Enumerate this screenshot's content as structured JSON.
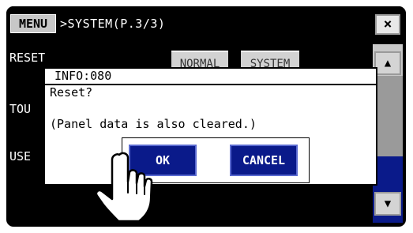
{
  "titlebar": {
    "menu_label": "MENU",
    "breadcrumb": ">SYSTEM(P.3/3)",
    "close_label": "×"
  },
  "settings": {
    "row1_label": "RESET",
    "row2_label": "TOU",
    "row3_label": "USE",
    "normal_button": "NORMAL",
    "system_button": "SYSTEM"
  },
  "scrollbar": {
    "up_icon": "triangle-up-icon",
    "down_icon": "triangle-down-icon",
    "up_glyph": "▲",
    "down_glyph": "▼"
  },
  "dialog": {
    "title": "INFO:080",
    "message": "Reset?",
    "note": "(Panel data is also cleared.)",
    "ok_label": "OK",
    "cancel_label": "CANCEL"
  },
  "colors": {
    "screen_background": "#000000",
    "button_blue": "#0a1a8a",
    "dialog_background": "#ffffff",
    "menu_gray": "#c7c7c7"
  },
  "pointer_icon": "hand-pointer-icon"
}
